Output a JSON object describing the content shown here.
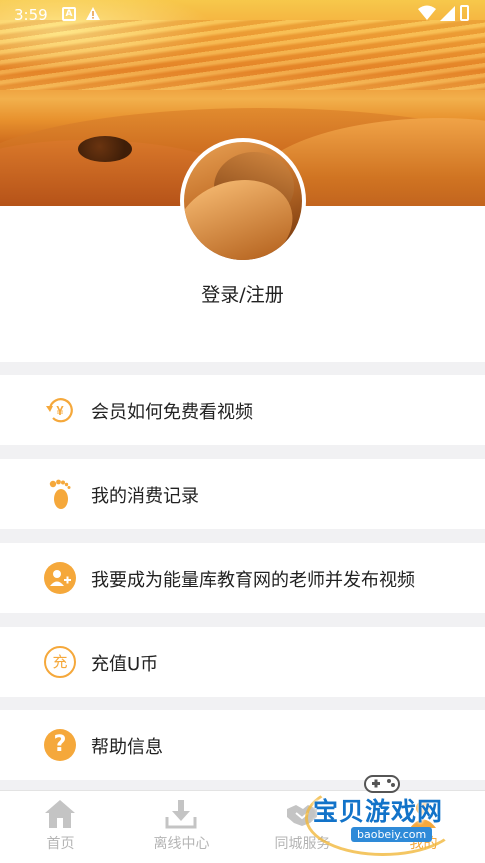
{
  "status_bar": {
    "time": "3:59",
    "a_icon": "A"
  },
  "profile": {
    "login_label": "登录/注册"
  },
  "menu": [
    {
      "label": "会员如何免费看视频",
      "icon": "yen-refresh-icon"
    },
    {
      "label": "我的消费记录",
      "icon": "footprint-icon"
    },
    {
      "label": "我要成为能量库教育网的老师并发布视频",
      "icon": "add-user-icon"
    },
    {
      "label": "充值U币",
      "icon": "recharge-icon",
      "icon_text": "充"
    },
    {
      "label": "帮助信息",
      "icon": "help-icon",
      "icon_text": "?"
    }
  ],
  "bottom_nav": [
    {
      "label": "首页",
      "icon": "home-icon"
    },
    {
      "label": "离线中心",
      "icon": "download-icon"
    },
    {
      "label": "同城服务",
      "icon": "handshake-icon"
    },
    {
      "label": "我的",
      "icon": "person-icon"
    }
  ],
  "watermark": {
    "title": "宝贝游戏网",
    "url": "baobeiy.com"
  },
  "colors": {
    "accent": "#f5a83b",
    "inactive_tab": "#b5b5b5",
    "divider": "#f1f1f3"
  }
}
